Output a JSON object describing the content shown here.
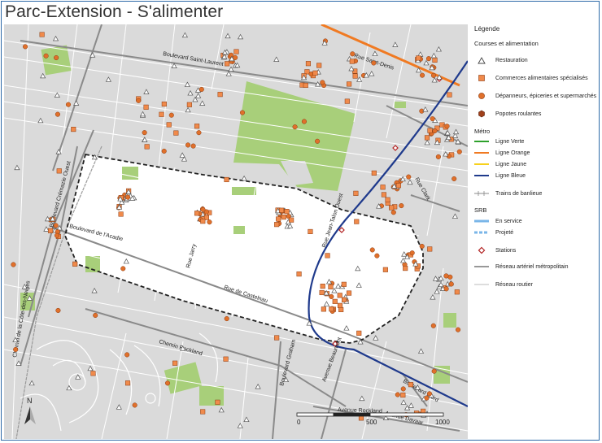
{
  "title": "Parc-Extension - S'alimenter",
  "legend": {
    "heading": "Légende",
    "sections": {
      "food": "Courses et alimentation",
      "metro": "Métro",
      "srb": "SRB"
    },
    "items": {
      "restauration": "Restauration",
      "commerces": "Commerces alimentaires spécialisés",
      "depanneurs": "Dépanneurs, épiceries et supermarchés",
      "popotes": "Popotes roulantes",
      "ligne_verte": "Ligne Verte",
      "ligne_orange": "Ligne Orange",
      "ligne_jaune": "Ligne Jaune",
      "ligne_bleue": "Ligne Bleue",
      "trains": "Trains de banlieue",
      "en_service": "En service",
      "projete": "Projeté",
      "stations": "Stations",
      "reseau_arteriel": "Réseau artériel métropolitain",
      "reseau_routier": "Réseau routier"
    }
  },
  "colors": {
    "orange_dot": "#e0702b",
    "ligne_verte": "#2ea12b",
    "ligne_orange": "#f07a22",
    "ligne_jaune": "#f7d11c",
    "ligne_bleue": "#1f3a8c",
    "srb": "#7ab6e8",
    "station": "#b22222",
    "park": "#a8cf7a",
    "road_bg": "#d9d9d9"
  },
  "streets": {
    "saint_laurent": "Boulevard Saint-Laurent",
    "saint_denis": "Rue Saint-Denis",
    "acadie": "Boulevard de l'Acadie",
    "cremazie": "Boulevard Crémazie Ouest",
    "jean_talon": "Rue Jean-Talon Ouest",
    "rue_jarry": "Rue Jarry",
    "rue_de_castelnau": "Rue de Castelnau",
    "parc": "Avenue du Parc",
    "rockland": "Chemin Rockland",
    "graham": "Boulevard Graham",
    "beaumont": "Avenue Beaumont",
    "davaar": "Avenue Davaar",
    "rockland_ave": "Avenue Rockland",
    "laird": "Boulevard Laird",
    "fleury": "Rue Fleury",
    "clark": "Rue Clark",
    "lajeunesse": "Rue Lajeunesse",
    "cote_vertu": "Chemin de la Côte-des-Neiges"
  },
  "scale": {
    "zero": "0",
    "mid": "500",
    "end": "1000"
  },
  "north": "N"
}
